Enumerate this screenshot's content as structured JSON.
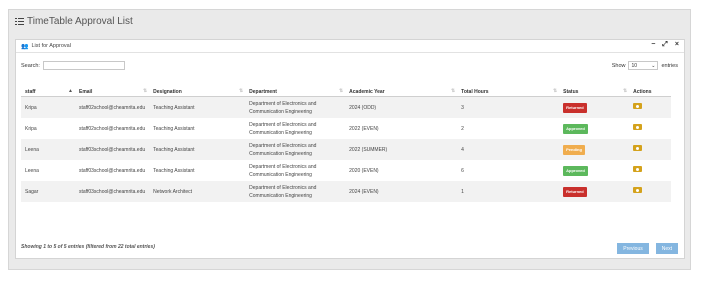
{
  "page": {
    "title": "TimeTable Approval List"
  },
  "panel": {
    "title": "List for Approval",
    "tools": {
      "minimize": "−",
      "expand": "⤢",
      "close": "×"
    }
  },
  "search": {
    "label": "Search:",
    "value": ""
  },
  "show": {
    "label_before": "Show",
    "selected": "10",
    "label_after": "entries"
  },
  "table": {
    "columns": [
      "staff",
      "Email",
      "Designation",
      "Department",
      "Academic Year",
      "Total Hours",
      "Status",
      "Actions"
    ],
    "rows": [
      {
        "staff": "Kripa",
        "email": "staff02school@cheamrita.edu",
        "designation": "Teaching Assistant",
        "dept_line1": "Department of Electronics and",
        "dept_line2": "Communication Engineering",
        "year": "2024 (ODD)",
        "hours": "3",
        "status": "Returned",
        "status_color": "#c9302c"
      },
      {
        "staff": "Kripa",
        "email": "staff02school@cheamrita.edu",
        "designation": "Teaching Assistant",
        "dept_line1": "Department of Electronics and",
        "dept_line2": "Communication Engineering",
        "year": "2022 (EVEN)",
        "hours": "2",
        "status": "Approved",
        "status_color": "#5cb85c"
      },
      {
        "staff": "Leena",
        "email": "staff03school@cheamrita.edu",
        "designation": "Teaching Assistant",
        "dept_line1": "Department of Electronics and",
        "dept_line2": "Communication Engineering",
        "year": "2022 (SUMMER)",
        "hours": "4",
        "status": "Pending",
        "status_color": "#f0ad4e"
      },
      {
        "staff": "Leena",
        "email": "staff03school@cheamrita.edu",
        "designation": "Teaching Assistant",
        "dept_line1": "Department of Electronics and",
        "dept_line2": "Communication Engineering",
        "year": "2020 (EVEN)",
        "hours": "6",
        "status": "Approved",
        "status_color": "#5cb85c"
      },
      {
        "staff": "Sagar",
        "email": "staff03school@cheamrita.edu",
        "designation": "Network Architect",
        "dept_line1": "Department of Electronics and",
        "dept_line2": "Communication Engineering",
        "year": "2024 (EVEN)",
        "hours": "1",
        "status": "Returned",
        "status_color": "#c9302c"
      }
    ]
  },
  "footer": {
    "info": "Showing 1 to 5 of 5 entries (filtered from 22 total entries)",
    "previous": "Previous",
    "next": "Next"
  },
  "icons": [
    "list-icon",
    "users-icon",
    "sort-icon",
    "chevron-down-icon",
    "eye-icon"
  ]
}
